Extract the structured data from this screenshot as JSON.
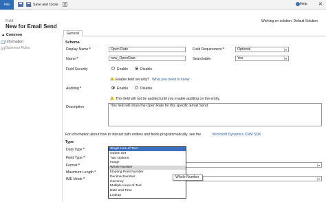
{
  "ribbon": {
    "file_label": "File",
    "save_close_label": "Save and Close",
    "help_label": "Help",
    "close_glyph": "✕"
  },
  "header": {
    "entity_label": "Field",
    "title": "New for Email Send",
    "solution_text": "Working on solution: Default Solution"
  },
  "nav": {
    "section_label": "Common",
    "items": [
      {
        "label": "Information",
        "icon": "info-page-icon"
      },
      {
        "label": "Business Rules",
        "icon": "rules-icon"
      }
    ]
  },
  "tabs": {
    "general": "General"
  },
  "schema": {
    "title": "Schema",
    "display_name_label": "Display Name",
    "display_name_value": "Open Rate",
    "field_requirement_label": "Field Requirement",
    "field_requirement_value": "Optional",
    "name_label": "Name",
    "name_value": "new_OpenRate",
    "searchable_label": "Searchable",
    "searchable_value": "Yes",
    "field_security_label": "Field Security",
    "field_security_options": [
      "Enable",
      "Disable"
    ],
    "field_security_selected": "Disable",
    "enable_security_text": "Enable field security?",
    "what_need_link": "What you need to know",
    "auditing_label": "Auditing",
    "auditing_options": [
      "Enable",
      "Disable"
    ],
    "auditing_selected": "Enable",
    "audit_warning": "This field will not be audited until you enable auditing on the entity.",
    "description_label": "Description",
    "description_value": "This field will show the Open Rate for this specific Email Send.",
    "sdk_text": "For information about how to interact with entities and fields programmatically, see the",
    "sdk_link": "Microsoft Dynamics CRM SDK"
  },
  "type_section": {
    "title": "Type",
    "data_type_label": "Data Type",
    "field_type_label": "Field Type",
    "format_label": "Format",
    "max_length_label": "Maximum Length",
    "ime_mode_label": "IME Mode",
    "data_type_options": [
      "Single Line of Text",
      "Option Set",
      "Two Options",
      "Image",
      "Whole Number",
      "Floating Point Number",
      "Decimal Number",
      "Currency",
      "Multiple Lines of Text",
      "Date and Time",
      "Lookup"
    ],
    "selected_option": "Single Line of Text",
    "hovered_option": "Whole Number",
    "tooltip": "Whole Number"
  },
  "colors": {
    "file_button": "#2c6db5",
    "selected_option": "#3b6fc0",
    "required_marker": "#cc0000",
    "link": "#2b5ea8"
  }
}
